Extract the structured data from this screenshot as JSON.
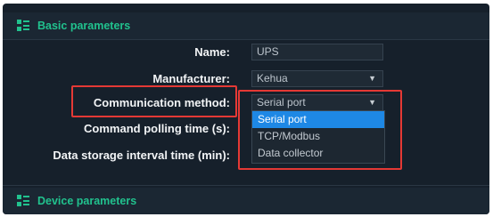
{
  "basic_section": {
    "title": "Basic parameters",
    "icon": "list-icon"
  },
  "fields": {
    "name": {
      "label": "Name:",
      "value": "UPS"
    },
    "manufacturer": {
      "label": "Manufacturer:",
      "value": "Kehua"
    },
    "communication_method": {
      "label": "Communication method:",
      "value": "Serial port"
    },
    "command_polling_time": {
      "label": "Command polling time (s):"
    },
    "data_storage_interval": {
      "label": "Data storage interval time (min):"
    }
  },
  "dropdown": {
    "options": [
      "Serial port",
      "TCP/Modbus",
      "Data collector"
    ],
    "selected_index": 0
  },
  "device_section": {
    "title": "Device parameters",
    "icon": "list-icon"
  },
  "colors": {
    "accent_green": "#21c28e",
    "selection_blue": "#1e88e5",
    "highlight_red": "#e53935",
    "panel_bg": "#16202b"
  }
}
